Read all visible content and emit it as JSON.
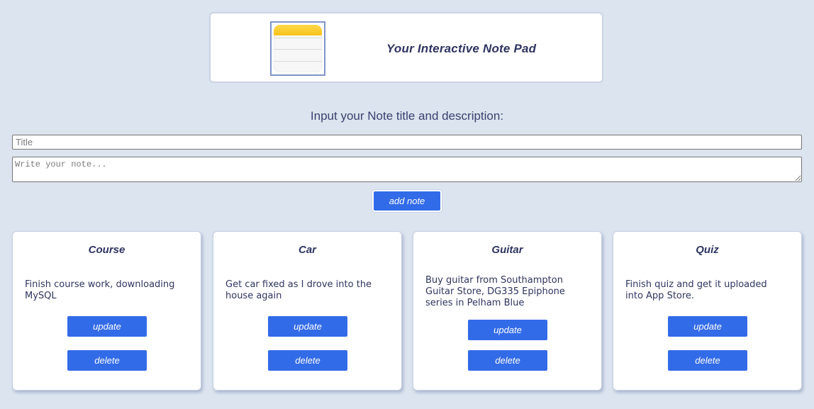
{
  "header": {
    "title": "Your Interactive Note Pad",
    "logo_icon": "notepad-icon"
  },
  "form": {
    "prompt": "Input your Note title and description:",
    "title_placeholder": "Title",
    "title_value": "",
    "note_placeholder": "Write your note...",
    "note_value": "",
    "add_label": "add note"
  },
  "notes": [
    {
      "title": "Course",
      "description": "Finish course work, downloading MySQL",
      "update_label": "update",
      "delete_label": "delete"
    },
    {
      "title": "Car",
      "description": "Get car fixed as I drove into the house again",
      "update_label": "update",
      "delete_label": "delete"
    },
    {
      "title": "Guitar",
      "description": "Buy guitar from Southampton Guitar Store, DG335 Epiphone series in Pelham Blue",
      "update_label": "update",
      "delete_label": "delete"
    },
    {
      "title": "Quiz",
      "description": "Finish quiz and get it uploaded into App Store.",
      "update_label": "update",
      "delete_label": "delete"
    }
  ],
  "colors": {
    "background": "#dce4ef",
    "accent": "#326be8",
    "text": "#2e3560"
  }
}
